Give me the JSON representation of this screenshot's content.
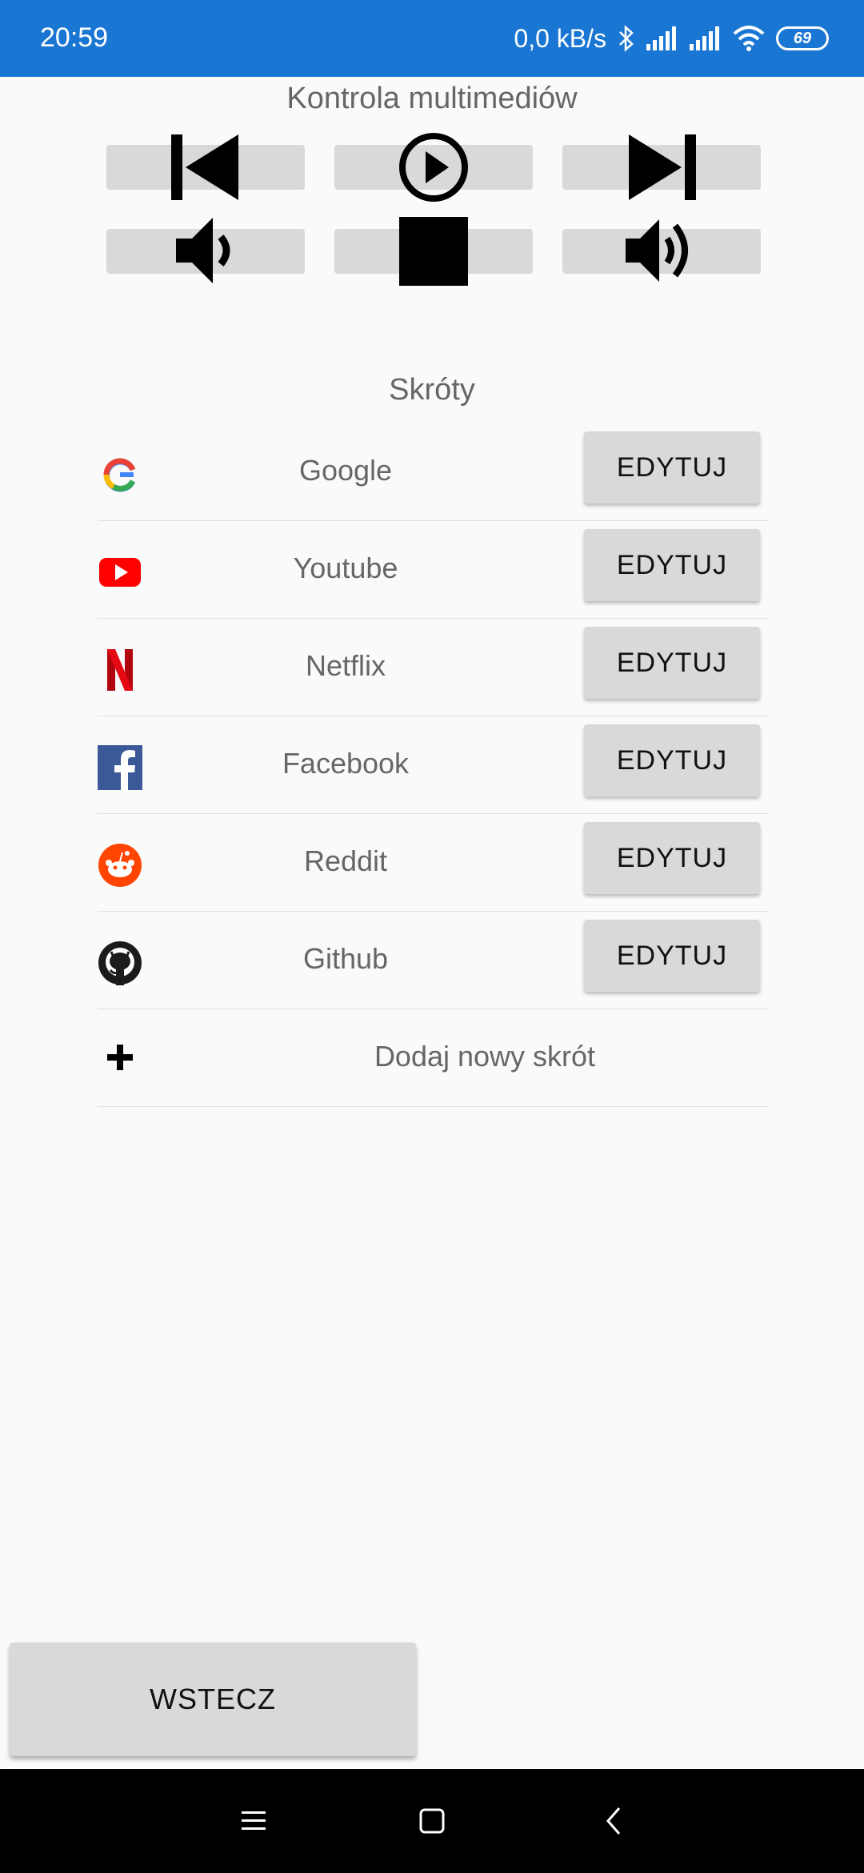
{
  "status_bar": {
    "time": "20:59",
    "network_speed": "0,0 kB/s",
    "battery": "69",
    "icons": [
      "bluetooth-icon",
      "signal-icon",
      "signal-icon",
      "wifi-icon",
      "battery-icon"
    ]
  },
  "media": {
    "title": "Kontrola multimediów",
    "buttons": [
      "previous-track-icon",
      "play-icon",
      "next-track-icon",
      "volume-down-icon",
      "stop-icon",
      "volume-up-icon"
    ]
  },
  "shortcuts": {
    "title": "Skróty",
    "items": [
      {
        "label": "Google",
        "icon": "google-icon",
        "button": "EDYTUJ"
      },
      {
        "label": "Youtube",
        "icon": "youtube-icon",
        "button": "EDYTUJ"
      },
      {
        "label": "Netflix",
        "icon": "netflix-icon",
        "button": "EDYTUJ"
      },
      {
        "label": "Facebook",
        "icon": "facebook-icon",
        "button": "EDYTUJ"
      },
      {
        "label": "Reddit",
        "icon": "reddit-icon",
        "button": "EDYTUJ"
      },
      {
        "label": "Github",
        "icon": "github-icon",
        "button": "EDYTUJ"
      }
    ],
    "add_label": "Dodaj nowy skrót"
  },
  "footer": {
    "back_label": "WSTECZ"
  },
  "colors": {
    "status_bar": "#1976d2",
    "button": "#d9d9d9",
    "background": "#fafafa"
  }
}
